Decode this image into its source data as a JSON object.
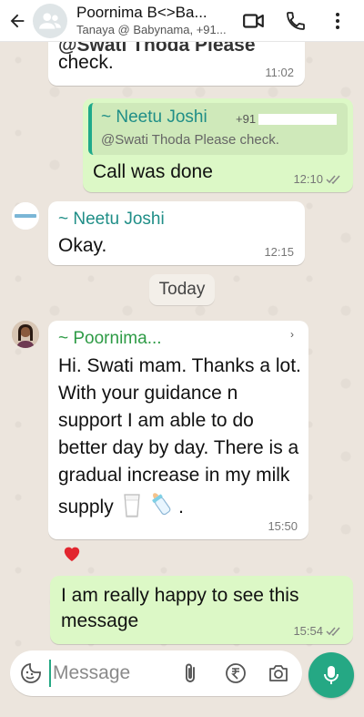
{
  "header": {
    "title": "Poornima B<>Ba...",
    "subtitle": "Tanaya @ Babynama, +91..."
  },
  "messages": {
    "m1": {
      "text_top": "@Swati Thoda Please",
      "text": "check.",
      "time": "11:02"
    },
    "m2": {
      "quote_name": "~ Neetu Joshi",
      "quote_phone": "+91",
      "quote_text": "@Swati Thoda Please check.",
      "text": "Call was done",
      "time": "12:10"
    },
    "m3": {
      "sender": "~ Neetu Joshi",
      "text": "Okay.",
      "time": "12:15"
    },
    "date_chip": "Today",
    "m4": {
      "sender": "~ Poornima...",
      "text": "Hi. Swati mam. Thanks a lot. With your guidance n support I am able to do better day by day. There is a gradual increase in my milk supply",
      "time": "15:50",
      "reaction": "heart"
    },
    "m5": {
      "text": "I am really happy to see this message",
      "time": "15:54"
    }
  },
  "input": {
    "placeholder": "Message"
  },
  "colors": {
    "accent": "#25A884",
    "outgoing_bubble": "#DCF8C6",
    "incoming_bubble": "#FFFFFF",
    "chat_bg": "#ECE5DD"
  },
  "icons": {
    "header": [
      "back-arrow-icon",
      "group-avatar-icon",
      "video-call-icon",
      "phone-icon",
      "more-vert-icon"
    ],
    "input": [
      "sticker-icon",
      "attach-icon",
      "rupee-payment-icon",
      "camera-icon",
      "mic-icon"
    ]
  }
}
